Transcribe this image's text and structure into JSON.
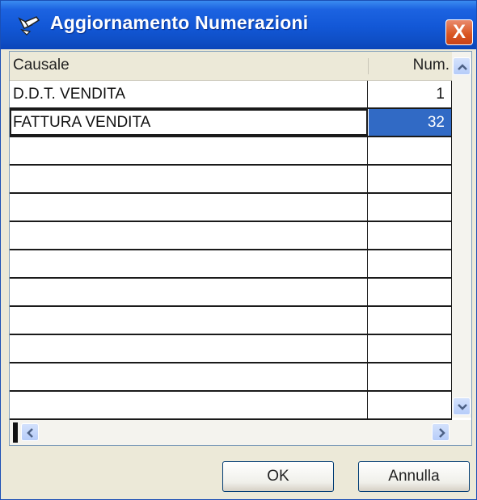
{
  "window": {
    "title": "Aggiornamento Numerazioni",
    "close_label": "X"
  },
  "grid": {
    "columns": [
      "Causale",
      "Num."
    ],
    "rows": [
      {
        "causale": "D.D.T. VENDITA",
        "num": "1"
      },
      {
        "causale": "FATTURA VENDITA",
        "num": "32"
      },
      {
        "causale": "",
        "num": ""
      },
      {
        "causale": "",
        "num": ""
      },
      {
        "causale": "",
        "num": ""
      },
      {
        "causale": "",
        "num": ""
      },
      {
        "causale": "",
        "num": ""
      },
      {
        "causale": "",
        "num": ""
      },
      {
        "causale": "",
        "num": ""
      },
      {
        "causale": "",
        "num": ""
      },
      {
        "causale": "",
        "num": ""
      },
      {
        "causale": "",
        "num": ""
      }
    ],
    "selected_row": 1
  },
  "buttons": {
    "ok": "OK",
    "cancel": "Annulla"
  },
  "colors": {
    "titlebar": "#1257D6",
    "selection": "#316AC5",
    "face": "#ECE9D8",
    "close": "#D9541F"
  },
  "icons": {
    "title": "pencil-arrow-icon",
    "close": "close-icon",
    "scroll_up": "chevron-up-icon",
    "scroll_down": "chevron-down-icon",
    "scroll_left": "chevron-left-icon",
    "scroll_right": "chevron-right-icon"
  }
}
